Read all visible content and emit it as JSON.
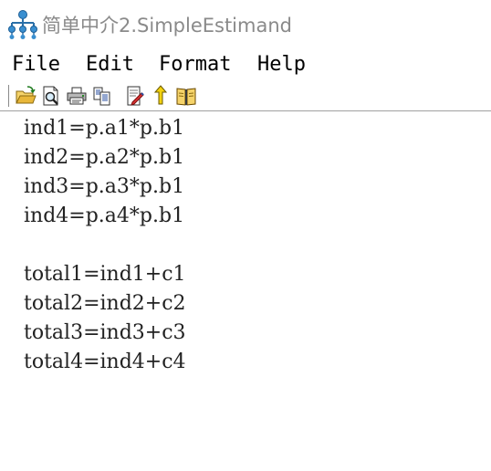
{
  "window": {
    "title": "简单中介2.SimpleEstimand",
    "icon": "network-tree-icon"
  },
  "menu": {
    "items": [
      "File",
      "Edit",
      "Format",
      "Help"
    ]
  },
  "toolbar": {
    "buttons": [
      "open-folder-icon",
      "print-preview-icon",
      "print-icon",
      "copy-icon",
      "edit-document-icon",
      "up-arrow-icon",
      "book-icon"
    ]
  },
  "editor": {
    "lines": [
      "ind1=p.a1*p.b1",
      "ind2=p.a2*p.b1",
      "ind3=p.a3*p.b1",
      "ind4=p.a4*p.b1",
      "",
      "total1=ind1+c1",
      "total2=ind2+c2",
      "total3=ind3+c3",
      "total4=ind4+c4"
    ]
  }
}
